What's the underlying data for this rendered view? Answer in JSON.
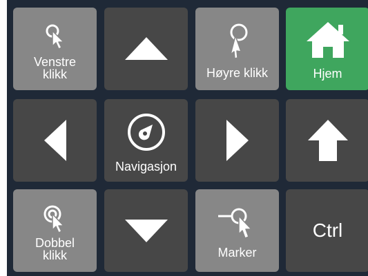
{
  "keys": {
    "left_click": {
      "label": "Venstre\nklikk",
      "icon": "single-click-cursor-icon"
    },
    "up": {
      "icon": "arrow-up-icon"
    },
    "right_click": {
      "label": "Høyre klikk",
      "icon": "right-click-cursor-icon"
    },
    "home": {
      "label": "Hjem",
      "icon": "home-icon"
    },
    "left": {
      "icon": "arrow-left-icon"
    },
    "navigation": {
      "label": "Navigasjon",
      "icon": "compass-icon"
    },
    "right": {
      "icon": "arrow-right-icon"
    },
    "shift": {
      "icon": "shift-arrow-icon"
    },
    "double_click": {
      "label": "Dobbel\nklikk",
      "icon": "double-click-cursor-icon"
    },
    "down": {
      "icon": "arrow-down-icon"
    },
    "select": {
      "label": "Marker",
      "icon": "select-drag-cursor-icon"
    },
    "ctrl": {
      "label": "Ctrl"
    }
  },
  "colors": {
    "background": "#1f2937",
    "light_tile": "#878787",
    "dark_tile": "#474747",
    "home_tile": "#3fa65e",
    "foreground": "#ffffff"
  }
}
